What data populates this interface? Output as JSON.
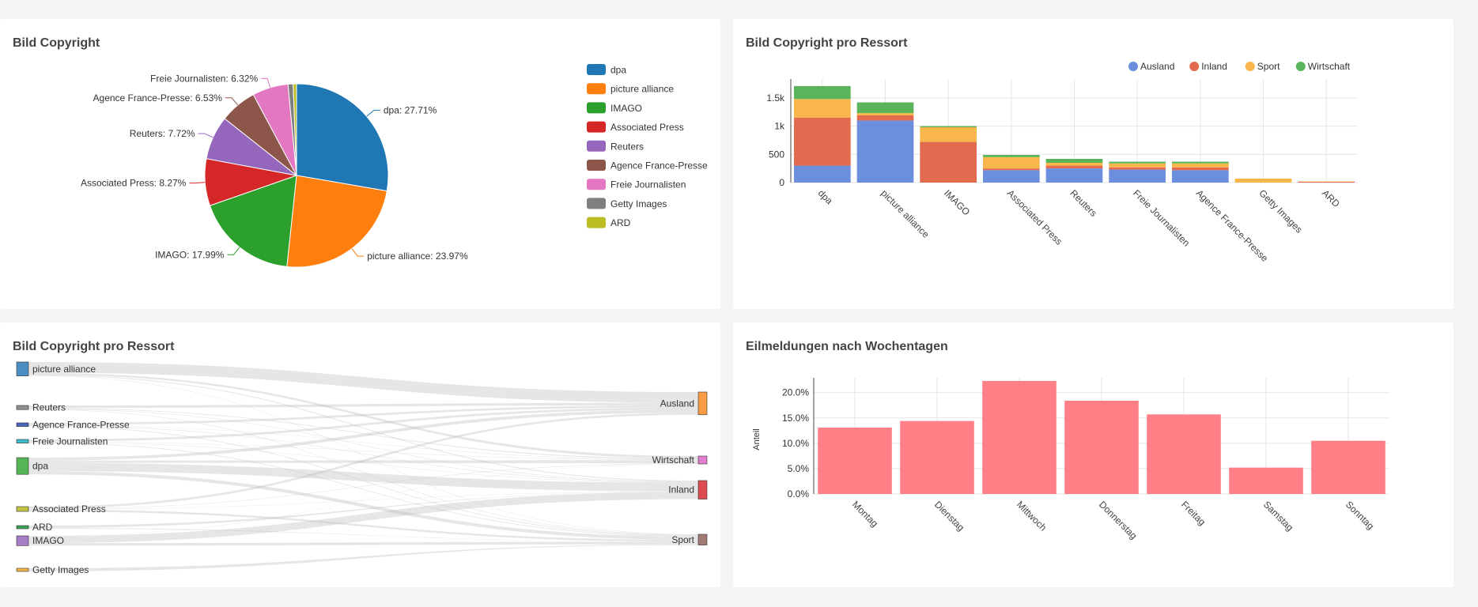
{
  "chart_data": [
    {
      "type": "pie",
      "title": "Bild Copyright",
      "slices": [
        {
          "label": "dpa",
          "value": 27.71,
          "color": "#1f77b4",
          "display": "dpa: 27.71%"
        },
        {
          "label": "picture alliance",
          "value": 23.97,
          "color": "#ff7f0e",
          "display": "picture alliance: 23.97%"
        },
        {
          "label": "IMAGO",
          "value": 17.99,
          "color": "#2ca02c",
          "display": "IMAGO: 17.99%"
        },
        {
          "label": "Associated Press",
          "value": 8.27,
          "color": "#d62728",
          "display": "Associated Press: 8.27%"
        },
        {
          "label": "Reuters",
          "value": 7.72,
          "color": "#9467bd",
          "display": "Reuters: 7.72%"
        },
        {
          "label": "Agence France-Presse",
          "value": 6.53,
          "color": "#8c564b",
          "display": "Agence France-Presse: 6.53%"
        },
        {
          "label": "Freie Journalisten",
          "value": 6.32,
          "color": "#e377c2",
          "display": "Freie Journalisten: 6.32%"
        },
        {
          "label": "Getty Images",
          "value": 0.9,
          "color": "#7f7f7f",
          "display": ""
        },
        {
          "label": "ARD",
          "value": 0.59,
          "color": "#bcbd22",
          "display": ""
        }
      ],
      "legend_position": "right"
    },
    {
      "type": "bar",
      "stacked": true,
      "title": "Bild Copyright pro Ressort",
      "categories": [
        "dpa",
        "picture alliance",
        "IMAGO",
        "Associated Press",
        "Reuters",
        "Freie Journalisten",
        "Agence France-Presse",
        "Getty Images",
        "ARD"
      ],
      "series": [
        {
          "name": "Ausland",
          "color": "#6b8fdd",
          "values": [
            300,
            1100,
            0,
            220,
            250,
            230,
            220,
            0,
            0
          ]
        },
        {
          "name": "Inland",
          "color": "#e26a4f",
          "values": [
            850,
            90,
            720,
            30,
            50,
            40,
            50,
            0,
            15
          ]
        },
        {
          "name": "Sport",
          "color": "#f9b64b",
          "values": [
            330,
            40,
            260,
            200,
            50,
            70,
            70,
            70,
            5
          ]
        },
        {
          "name": "Wirtschaft",
          "color": "#5bb45b",
          "values": [
            230,
            190,
            20,
            40,
            70,
            30,
            30,
            0,
            0
          ]
        }
      ],
      "y_ticks": [
        "0",
        "500",
        "1k",
        "1.5k"
      ],
      "ylim": [
        0,
        1750
      ],
      "legend_position": "top-right",
      "grid": true
    },
    {
      "type": "sankey",
      "title": "Bild Copyright pro Ressort",
      "sources": [
        {
          "label": "picture alliance",
          "color": "#4a8ec4",
          "value": 1420
        },
        {
          "label": "Reuters",
          "color": "#8f8f8f",
          "value": 420
        },
        {
          "label": "Agence France-Presse",
          "color": "#4867b6",
          "value": 370
        },
        {
          "label": "Freie Journalisten",
          "color": "#39bccc",
          "value": 370
        },
        {
          "label": "dpa",
          "color": "#55b456",
          "value": 1710
        },
        {
          "label": "Associated Press",
          "color": "#c4c244",
          "value": 490
        },
        {
          "label": "ARD",
          "color": "#3aa058",
          "value": 20
        },
        {
          "label": "IMAGO",
          "color": "#a57ec6",
          "value": 1000
        },
        {
          "label": "Getty Images",
          "color": "#f0b543",
          "value": 70
        }
      ],
      "targets": [
        {
          "label": "Ausland",
          "color": "#f99c43",
          "value": 2320
        },
        {
          "label": "Wirtschaft",
          "color": "#e07fd0",
          "value": 610
        },
        {
          "label": "Inland",
          "color": "#dd4a50",
          "value": 1895
        },
        {
          "label": "Sport",
          "color": "#a27b74",
          "value": 1095
        }
      ],
      "links": [
        [
          0,
          0,
          1100
        ],
        [
          0,
          1,
          190
        ],
        [
          0,
          2,
          90
        ],
        [
          0,
          3,
          40
        ],
        [
          1,
          0,
          250
        ],
        [
          1,
          1,
          70
        ],
        [
          1,
          2,
          50
        ],
        [
          1,
          3,
          50
        ],
        [
          2,
          0,
          220
        ],
        [
          2,
          1,
          30
        ],
        [
          2,
          2,
          50
        ],
        [
          2,
          3,
          70
        ],
        [
          3,
          0,
          230
        ],
        [
          3,
          1,
          30
        ],
        [
          3,
          2,
          40
        ],
        [
          3,
          3,
          70
        ],
        [
          4,
          0,
          300
        ],
        [
          4,
          1,
          230
        ],
        [
          4,
          2,
          850
        ],
        [
          4,
          3,
          330
        ],
        [
          5,
          0,
          220
        ],
        [
          5,
          1,
          40
        ],
        [
          5,
          2,
          30
        ],
        [
          5,
          3,
          200
        ],
        [
          6,
          2,
          15
        ],
        [
          6,
          3,
          5
        ],
        [
          7,
          1,
          20
        ],
        [
          7,
          2,
          720
        ],
        [
          7,
          3,
          260
        ],
        [
          8,
          3,
          70
        ]
      ]
    },
    {
      "type": "bar",
      "title": "Eilmeldungen nach Wochentagen",
      "categories": [
        "Montag",
        "Dienstag",
        "Mittwoch",
        "Donnerstag",
        "Freitag",
        "Samstag",
        "Sonntag"
      ],
      "values": [
        13.1,
        14.4,
        22.3,
        18.4,
        15.7,
        5.2,
        10.5
      ],
      "ylabel": "Anteil",
      "y_ticks": [
        "0.0%",
        "5.0%",
        "10.0%",
        "15.0%",
        "20.0%"
      ],
      "ylim": [
        0,
        22.3
      ],
      "color": "#ff7f86",
      "grid": true
    }
  ]
}
